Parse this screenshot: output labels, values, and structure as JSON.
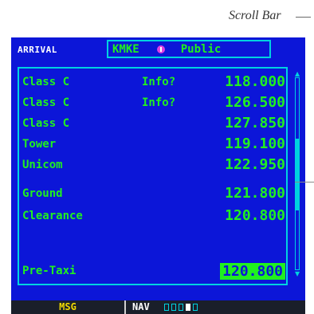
{
  "callout": {
    "scroll_bar": "Scroll Bar"
  },
  "header": {
    "page_label": "ARRIVAL",
    "identifier": "KMKE",
    "airport_type": "Public"
  },
  "frequencies": [
    {
      "name": "Class C",
      "info": "Info?",
      "freq": "118.000",
      "selected": false
    },
    {
      "name": "Class C",
      "info": "Info?",
      "freq": "126.500",
      "selected": false
    },
    {
      "name": "Class C",
      "info": "",
      "freq": "127.850",
      "selected": false
    },
    {
      "name": "Tower",
      "info": "",
      "freq": "119.100",
      "selected": false
    },
    {
      "name": "Unicom",
      "info": "",
      "freq": "122.950",
      "selected": false
    },
    {
      "name": "Ground",
      "info": "",
      "freq": "121.800",
      "selected": false
    },
    {
      "name": "Clearance",
      "info": "",
      "freq": "120.800",
      "selected": false
    },
    {
      "name": "Pre-Taxi",
      "info": "",
      "freq": "120.800",
      "selected": true
    }
  ],
  "status": {
    "msg": "MSG",
    "nav": "NAV"
  },
  "colors": {
    "background": "#0c16d8",
    "text": "#20f020",
    "border": "#00d2e0",
    "msg": "#f0d800"
  }
}
